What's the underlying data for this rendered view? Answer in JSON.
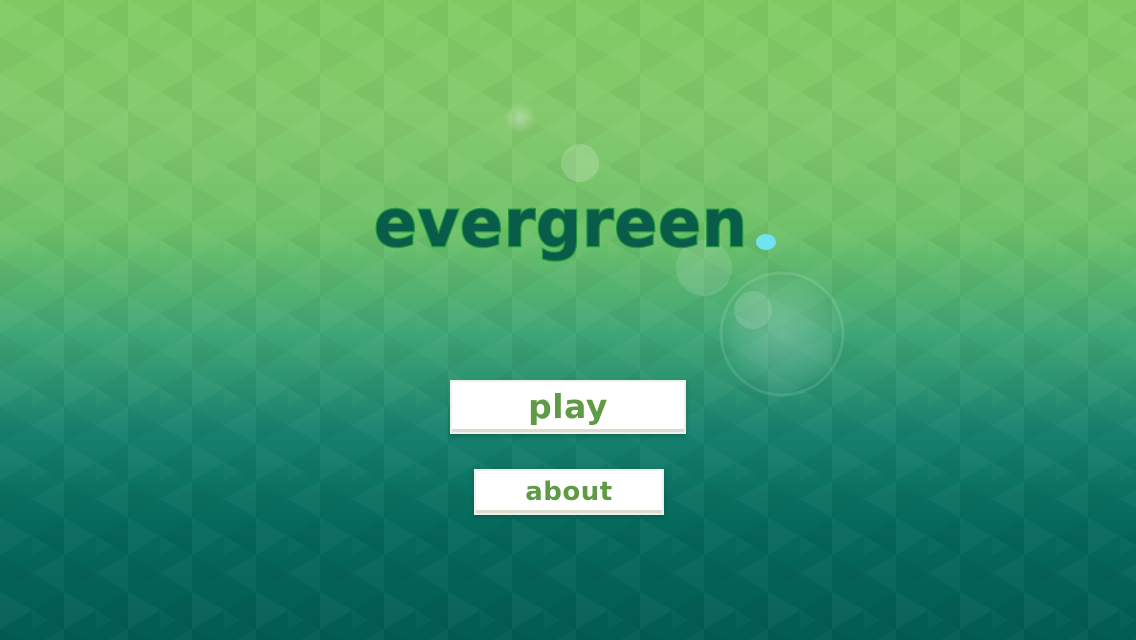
{
  "game": {
    "title": "evergreen"
  },
  "menu": {
    "play_label": "play",
    "about_label": "about"
  },
  "colors": {
    "title_fill": "#0a5c4a",
    "title_stroke": "#1f9a3e",
    "title_dot": "#6fe3f0",
    "button_text": "#5f9a45",
    "button_bg": "#ffffff",
    "background_top": "#7fcb62",
    "background_bottom": "#025c52"
  }
}
